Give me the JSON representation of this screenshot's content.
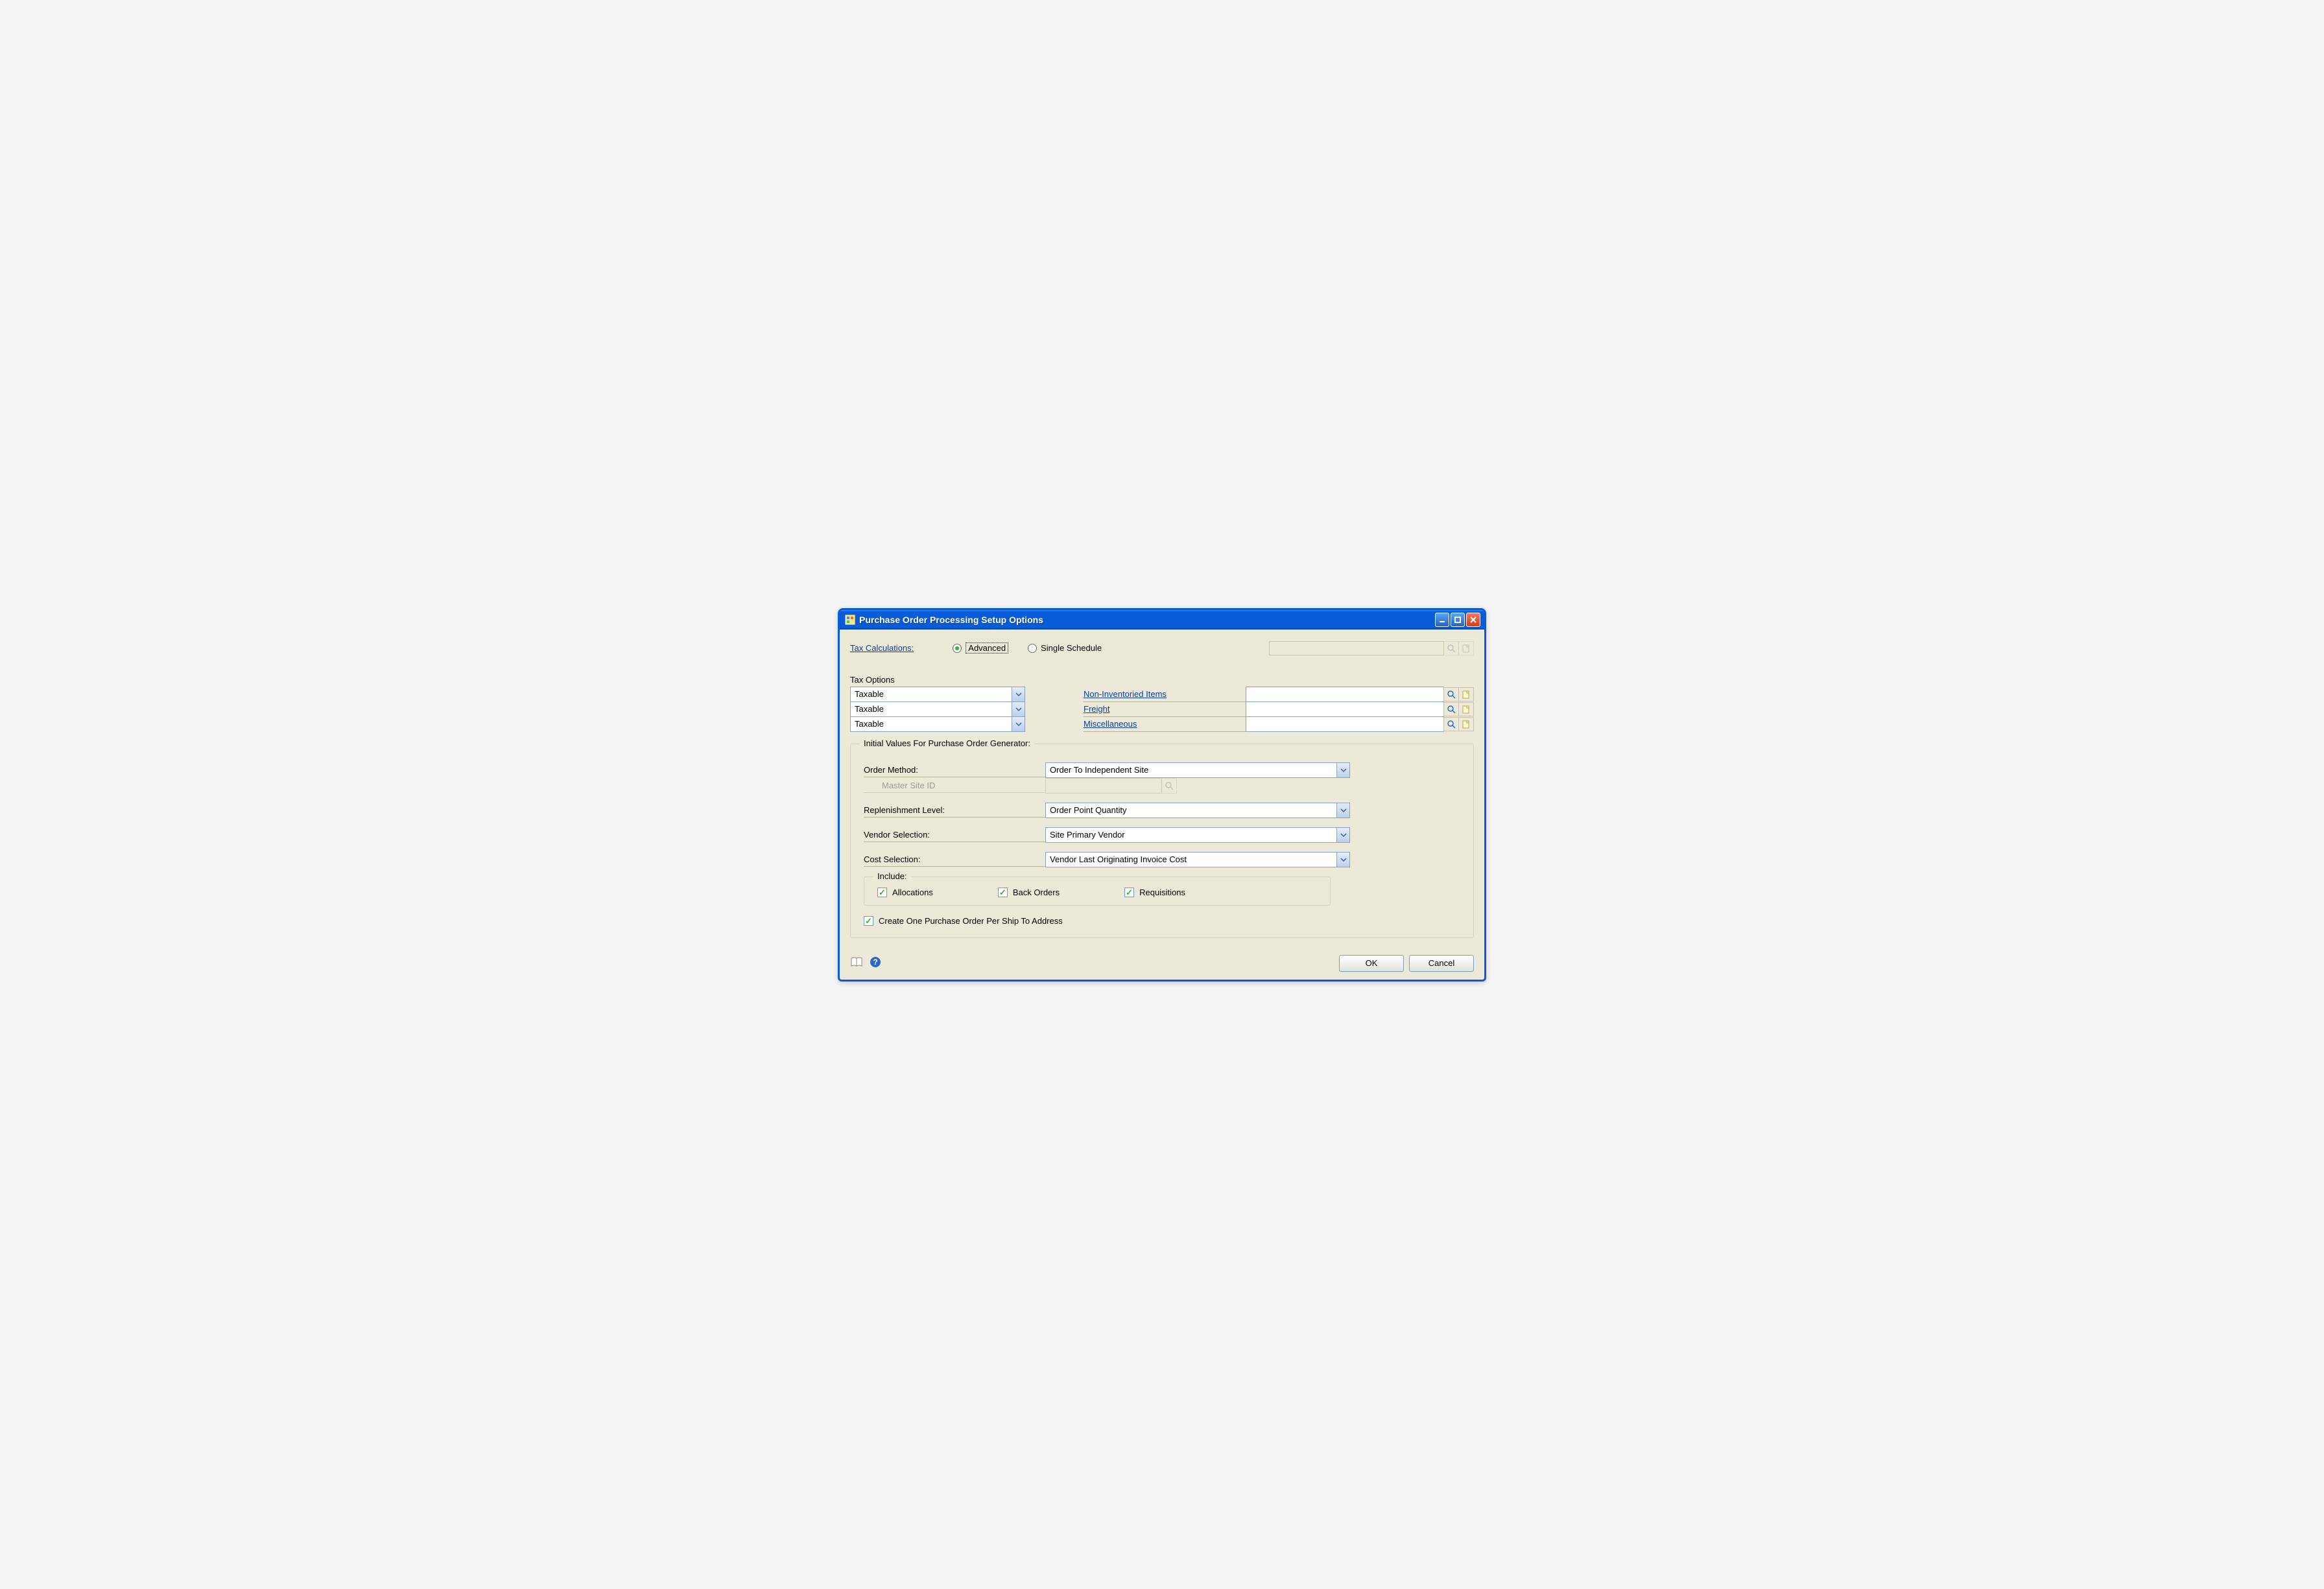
{
  "window": {
    "title": "Purchase Order Processing Setup Options"
  },
  "taxCalc": {
    "label": "Tax Calculations:",
    "options": {
      "advanced": "Advanced",
      "single": "Single Schedule"
    },
    "selected": "advanced"
  },
  "taxOptions": {
    "label": "Tax Options",
    "rows": [
      {
        "value": "Taxable",
        "linkLabel": "Non-Inventoried Items"
      },
      {
        "value": "Taxable",
        "linkLabel": "Freight"
      },
      {
        "value": "Taxable",
        "linkLabel": "Miscellaneous"
      }
    ]
  },
  "poGen": {
    "legend": "Initial Values For Purchase Order Generator:",
    "orderMethod": {
      "label": "Order Method:",
      "value": "Order To Independent Site"
    },
    "masterSite": {
      "label": "Master Site ID",
      "value": ""
    },
    "replenishment": {
      "label": "Replenishment Level:",
      "value": "Order Point Quantity"
    },
    "vendorSelection": {
      "label": "Vendor Selection:",
      "value": "Site Primary Vendor"
    },
    "costSelection": {
      "label": "Cost Selection:",
      "value": "Vendor Last Originating Invoice Cost"
    },
    "include": {
      "legend": "Include:",
      "allocations": "Allocations",
      "backOrders": "Back Orders",
      "requisitions": "Requisitions"
    },
    "createOnePerShip": "Create One Purchase Order Per Ship To Address"
  },
  "buttons": {
    "ok": "OK",
    "cancel": "Cancel"
  }
}
